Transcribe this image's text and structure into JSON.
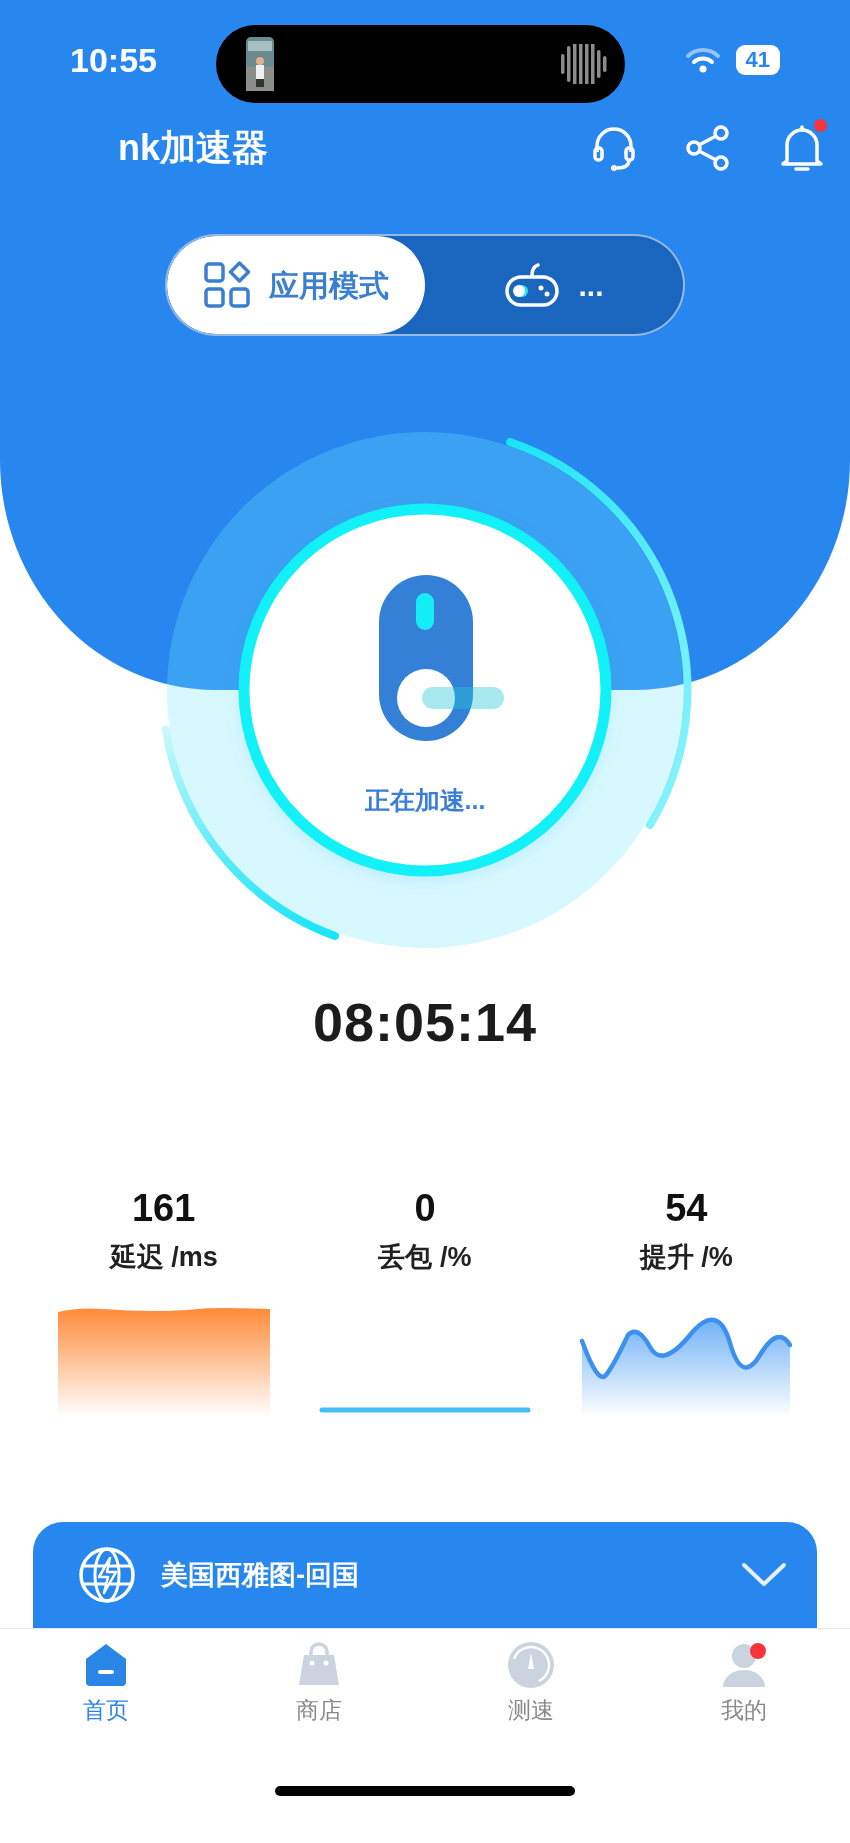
{
  "status_bar": {
    "time": "10:55",
    "battery": "41"
  },
  "header": {
    "title": "nk加速器",
    "has_notification": true
  },
  "mode_tabs": [
    {
      "label": "应用模式",
      "kind": "apps",
      "selected": true
    },
    {
      "label": "...",
      "kind": "gamepad",
      "selected": false
    }
  ],
  "dial": {
    "status": "正在加速..."
  },
  "timer": "08:05:14",
  "stats": [
    {
      "value": "161",
      "label": "延迟 /ms",
      "kind": "area"
    },
    {
      "value": "0",
      "label": "丢包 /%",
      "kind": "flat"
    },
    {
      "value": "54",
      "label": "提升 /%",
      "kind": "wave"
    }
  ],
  "server": {
    "name": "美国西雅图-回国",
    "expanded": false
  },
  "tab_bar": [
    {
      "label": "首页",
      "kind": "home",
      "selected": true,
      "has_dot": false
    },
    {
      "label": "商店",
      "kind": "shop",
      "selected": false,
      "has_dot": false
    },
    {
      "label": "测速",
      "kind": "speed",
      "selected": false,
      "has_dot": false
    },
    {
      "label": "我的",
      "kind": "profile",
      "selected": false,
      "has_dot": true
    }
  ]
}
